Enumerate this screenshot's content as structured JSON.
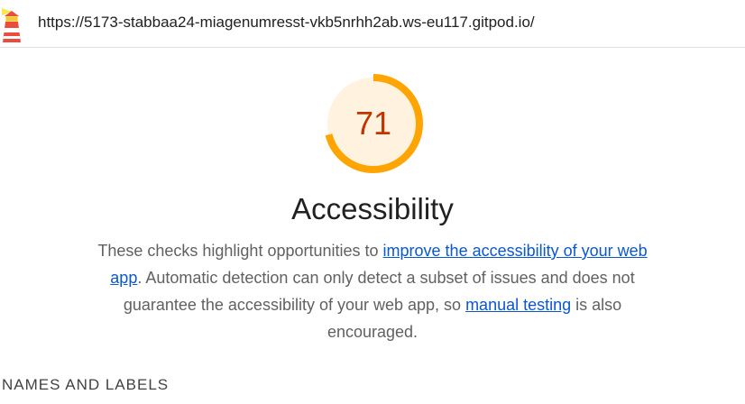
{
  "topbar": {
    "logo_icon": "lighthouse-icon",
    "url": "https://5173-stabbaa24-miagenumresst-vkb5nrhh2ab.ws-eu117.gitpod.io/"
  },
  "gauge": {
    "score": "71",
    "fraction": 0.71,
    "color": "#ffa400",
    "background": "#fff3e0",
    "text_color": "#c33300"
  },
  "category": {
    "title": "Accessibility",
    "description": {
      "part1": "These checks highlight opportunities to ",
      "link1": "improve the accessibility of your web app",
      "part2": ". Automatic detection can only detect a subset of issues and does not guarantee the accessibility of your web app, so ",
      "link2": "manual testing",
      "part3": " is also encouraged."
    }
  },
  "section": {
    "title": "NAMES AND LABELS"
  }
}
